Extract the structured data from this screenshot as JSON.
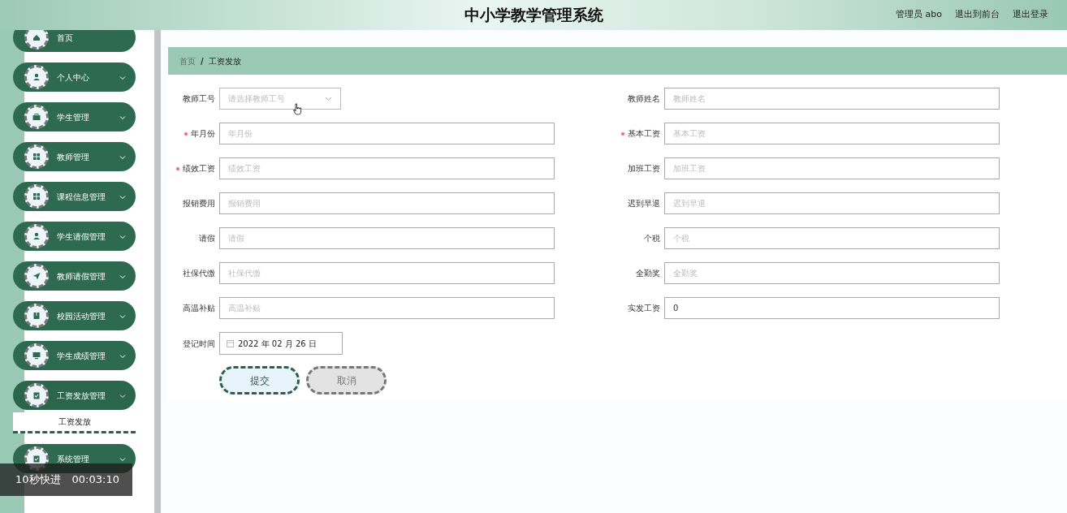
{
  "header": {
    "title": "中小学教学管理系统",
    "links": [
      "管理员 abo",
      "退出到前台",
      "退出登录"
    ]
  },
  "sidebar": {
    "items": [
      {
        "label": "首页",
        "kind": "home",
        "expandable": false
      },
      {
        "label": "个人中心",
        "kind": "user",
        "expandable": true,
        "expanded": false
      },
      {
        "label": "学生管理",
        "kind": "briefcase",
        "expandable": true,
        "expanded": false
      },
      {
        "label": "教师管理",
        "kind": "grid",
        "expandable": true,
        "expanded": false
      },
      {
        "label": "课程信息管理",
        "kind": "grid",
        "expandable": true,
        "expanded": false
      },
      {
        "label": "学生请假管理",
        "kind": "user",
        "expandable": true,
        "expanded": false
      },
      {
        "label": "教师请假管理",
        "kind": "send",
        "expandable": true,
        "expanded": false
      },
      {
        "label": "校园活动管理",
        "kind": "book",
        "expandable": true,
        "expanded": false
      },
      {
        "label": "学生成绩管理",
        "kind": "monitor",
        "expandable": true,
        "expanded": false
      },
      {
        "label": "工资发放管理",
        "kind": "clipboard",
        "expandable": true,
        "expanded": true,
        "children": [
          {
            "label": "工资发放",
            "selected": true
          }
        ]
      },
      {
        "label": "系统管理",
        "kind": "clipboard",
        "expandable": true,
        "expanded": false
      }
    ]
  },
  "breadcrumb": {
    "items": [
      "首页",
      "工资发放"
    ],
    "separator": "/"
  },
  "form": {
    "fields": [
      {
        "kind": "select",
        "label": "教师工号",
        "required": false,
        "placeholder": "请选择教师工号"
      },
      {
        "kind": "text",
        "label": "教师姓名",
        "required": false,
        "placeholder": "教师姓名"
      },
      {
        "kind": "text",
        "label": "年月份",
        "required": true,
        "placeholder": "年月份"
      },
      {
        "kind": "text",
        "label": "基本工资",
        "required": true,
        "placeholder": "基本工资"
      },
      {
        "kind": "text",
        "label": "绩效工资",
        "required": true,
        "placeholder": "绩效工资"
      },
      {
        "kind": "text",
        "label": "加班工资",
        "required": false,
        "placeholder": "加班工资"
      },
      {
        "kind": "text",
        "label": "报销费用",
        "required": false,
        "placeholder": "报销费用"
      },
      {
        "kind": "text",
        "label": "迟到早退",
        "required": false,
        "placeholder": "迟到早退"
      },
      {
        "kind": "text",
        "label": "请假",
        "required": false,
        "placeholder": "请假"
      },
      {
        "kind": "text",
        "label": "个税",
        "required": false,
        "placeholder": "个税"
      },
      {
        "kind": "text",
        "label": "社保代缴",
        "required": false,
        "placeholder": "社保代缴"
      },
      {
        "kind": "text",
        "label": "全勤奖",
        "required": false,
        "placeholder": "全勤奖"
      },
      {
        "kind": "text",
        "label": "高温补贴",
        "required": false,
        "placeholder": "高温补贴"
      },
      {
        "kind": "text",
        "label": "实发工资",
        "required": false,
        "value": "0"
      },
      {
        "kind": "date",
        "label": "登记时间",
        "required": false,
        "value": "2022 年 02 月 26 日"
      }
    ],
    "buttons": [
      {
        "label": "提交",
        "kind": "primary"
      },
      {
        "label": "取消",
        "kind": "secondary"
      }
    ]
  },
  "video_overlay": {
    "skip": "10秒快进",
    "time": "00:03:10"
  }
}
